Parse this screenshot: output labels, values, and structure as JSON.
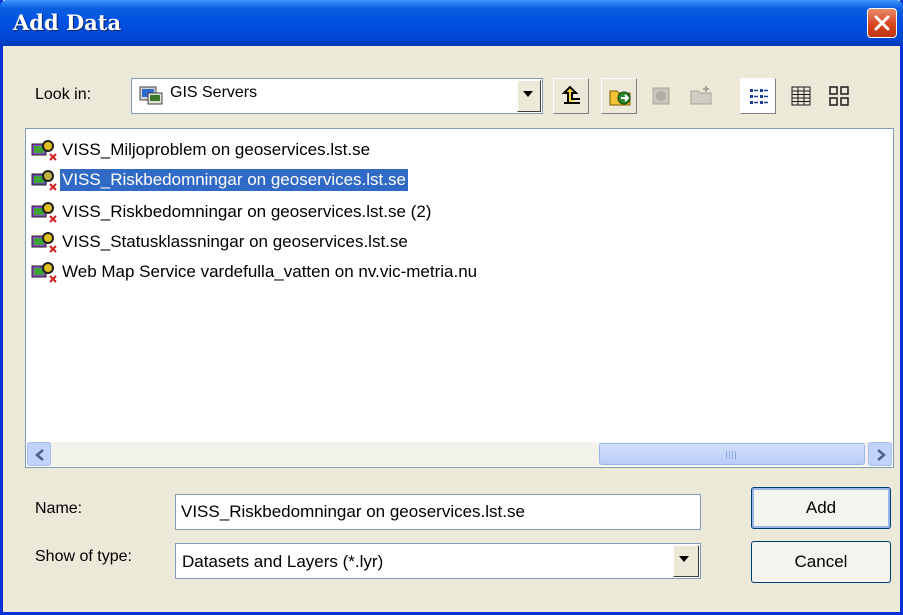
{
  "window": {
    "title": "Add Data"
  },
  "lookin": {
    "label": "Look in:",
    "value": "GIS Servers"
  },
  "toolbar": {
    "icons": [
      "up-one-level-icon",
      "connect-to-folder-icon",
      "disconnect-icon",
      "new-folder-icon",
      "list-view-icon",
      "details-view-icon",
      "thumbnails-view-icon"
    ]
  },
  "files": [
    {
      "label": "VISS_Miljoproblem on geoservices.lst.se",
      "selected": false
    },
    {
      "label": "VISS_Riskbedomningar on geoservices.lst.se",
      "selected": true
    },
    {
      "label": "VISS_Riskbedomningar on geoservices.lst.se (2)",
      "selected": false
    },
    {
      "label": "VISS_Statusklassningar on geoservices.lst.se",
      "selected": false
    },
    {
      "label": "Web Map Service vardefulla_vatten on nv.vic-metria.nu",
      "selected": false
    }
  ],
  "name": {
    "label": "Name:",
    "value": "VISS_Riskbedomningar on geoservices.lst.se"
  },
  "type": {
    "label": "Show of type:",
    "value": "Datasets and Layers (*.lyr)"
  },
  "buttons": {
    "add": "Add",
    "cancel": "Cancel"
  },
  "colors": {
    "titlebar": "#0050e0",
    "selection": "#316ac5",
    "dialog_bg": "#ece9d8"
  }
}
